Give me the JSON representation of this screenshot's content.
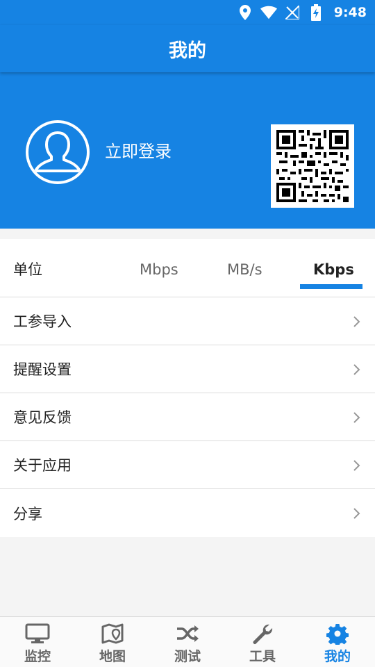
{
  "status_bar": {
    "time": "9:48"
  },
  "app_bar": {
    "title": "我的"
  },
  "profile": {
    "login_text": "立即登录"
  },
  "unit": {
    "label": "单位",
    "options": [
      "Mbps",
      "MB/s",
      "Kbps"
    ],
    "selected": "Kbps"
  },
  "menu": {
    "items": [
      {
        "label": "工参导入"
      },
      {
        "label": "提醒设置"
      },
      {
        "label": "意见反馈"
      },
      {
        "label": "关于应用"
      },
      {
        "label": "分享"
      }
    ]
  },
  "bottom_nav": {
    "items": [
      {
        "label": "监控",
        "icon": "monitor-icon"
      },
      {
        "label": "地图",
        "icon": "map-icon"
      },
      {
        "label": "测试",
        "icon": "shuffle-icon"
      },
      {
        "label": "工具",
        "icon": "wrench-icon"
      },
      {
        "label": "我的",
        "icon": "gear-icon"
      }
    ],
    "active": "我的"
  },
  "colors": {
    "primary": "#1683e3",
    "inactive": "#666666"
  }
}
